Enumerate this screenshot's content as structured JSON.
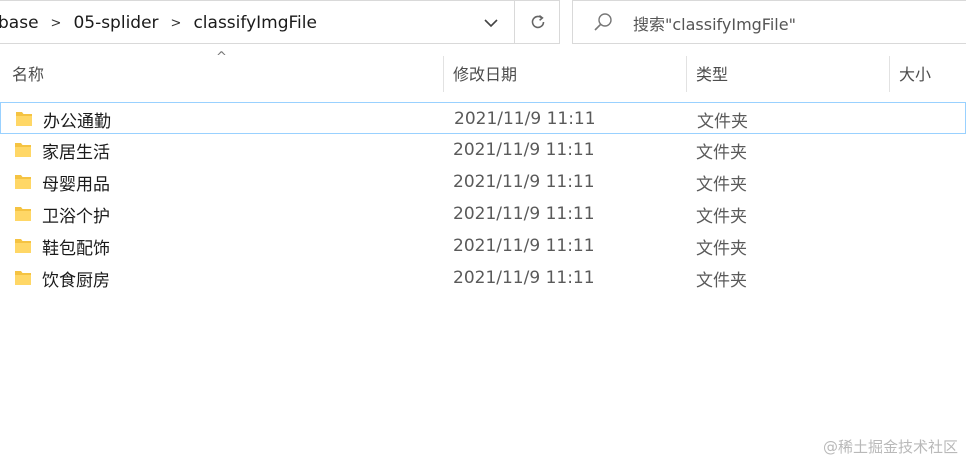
{
  "address_bar": {
    "crumbs": [
      "base",
      "05-splider",
      "classifyImgFile"
    ],
    "separator": ">"
  },
  "search": {
    "placeholder": "搜索\"classifyImgFile\""
  },
  "columns": {
    "name": "名称",
    "date": "修改日期",
    "type": "类型",
    "size": "大小"
  },
  "files": [
    {
      "name": "办公通勤",
      "date": "2021/11/9 11:11",
      "type": "文件夹"
    },
    {
      "name": "家居生活",
      "date": "2021/11/9 11:11",
      "type": "文件夹"
    },
    {
      "name": "母婴用品",
      "date": "2021/11/9 11:11",
      "type": "文件夹"
    },
    {
      "name": "卫浴个护",
      "date": "2021/11/9 11:11",
      "type": "文件夹"
    },
    {
      "name": "鞋包配饰",
      "date": "2021/11/9 11:11",
      "type": "文件夹"
    },
    {
      "name": "饮食厨房",
      "date": "2021/11/9 11:11",
      "type": "文件夹"
    }
  ],
  "watermark": "@稀土掘金技术社区",
  "colors": {
    "folder": "#f5c342",
    "focus_border": "#99d1ff"
  }
}
